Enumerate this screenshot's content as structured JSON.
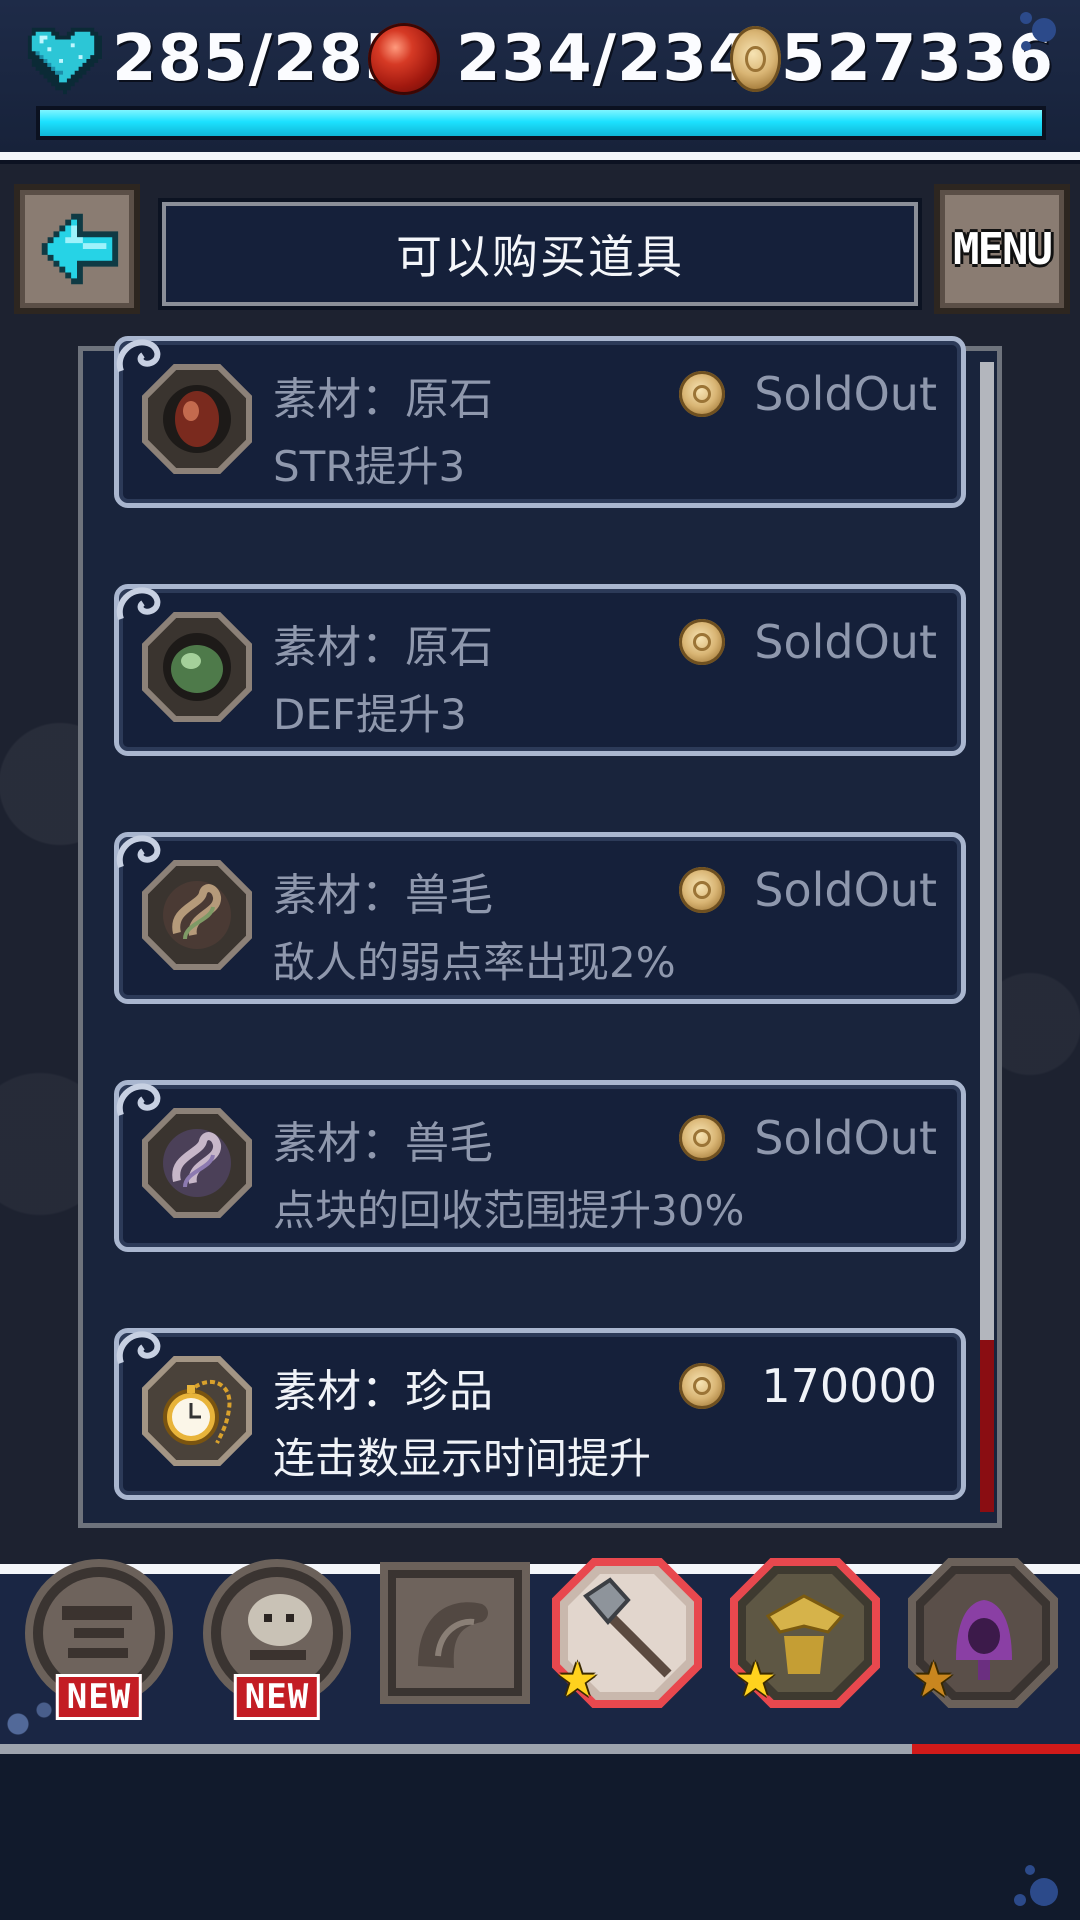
{
  "status": {
    "hp": "285/285",
    "mp": "234/234",
    "gold": "527336",
    "hp_fraction": 1.0
  },
  "header": {
    "title": "可以购买道具",
    "menu_label": "MENU"
  },
  "shop_items": [
    {
      "category": "素材：原石",
      "description": "STR提升3",
      "price": "SoldOut",
      "sold_out": true,
      "icon": "red-gem-icon"
    },
    {
      "category": "素材：原石",
      "description": "DEF提升3",
      "price": "SoldOut",
      "sold_out": true,
      "icon": "green-gem-icon"
    },
    {
      "category": "素材：兽毛",
      "description": "敌人的弱点率出现2%",
      "price": "SoldOut",
      "sold_out": true,
      "icon": "fur-swirl-icon"
    },
    {
      "category": "素材：兽毛",
      "description": "点块的回收范围提升30%",
      "price": "SoldOut",
      "sold_out": true,
      "icon": "fur-swirl-icon"
    },
    {
      "category": "素材：珍品",
      "description": "连击数显示时间提升",
      "price": "170000",
      "sold_out": false,
      "icon": "pocket-watch-icon"
    }
  ],
  "bottom_slots": {
    "new_label": "NEW",
    "slots": [
      {
        "icon": "monster-face-icon",
        "badge": "NEW"
      },
      {
        "icon": "ghost-creature-icon",
        "badge": "NEW"
      },
      {
        "icon": "shell-creature-icon",
        "badge": ""
      },
      {
        "icon": "axe-weapon-icon",
        "badge": "star"
      },
      {
        "icon": "gold-armor-icon",
        "badge": "star"
      },
      {
        "icon": "purple-hood-icon",
        "badge": "star"
      }
    ]
  },
  "colors": {
    "hp_bar": "#1ce1ff",
    "selected_ring": "#e8484e",
    "new_badge": "#c31d24",
    "scroll_red": "#8a0d12"
  }
}
